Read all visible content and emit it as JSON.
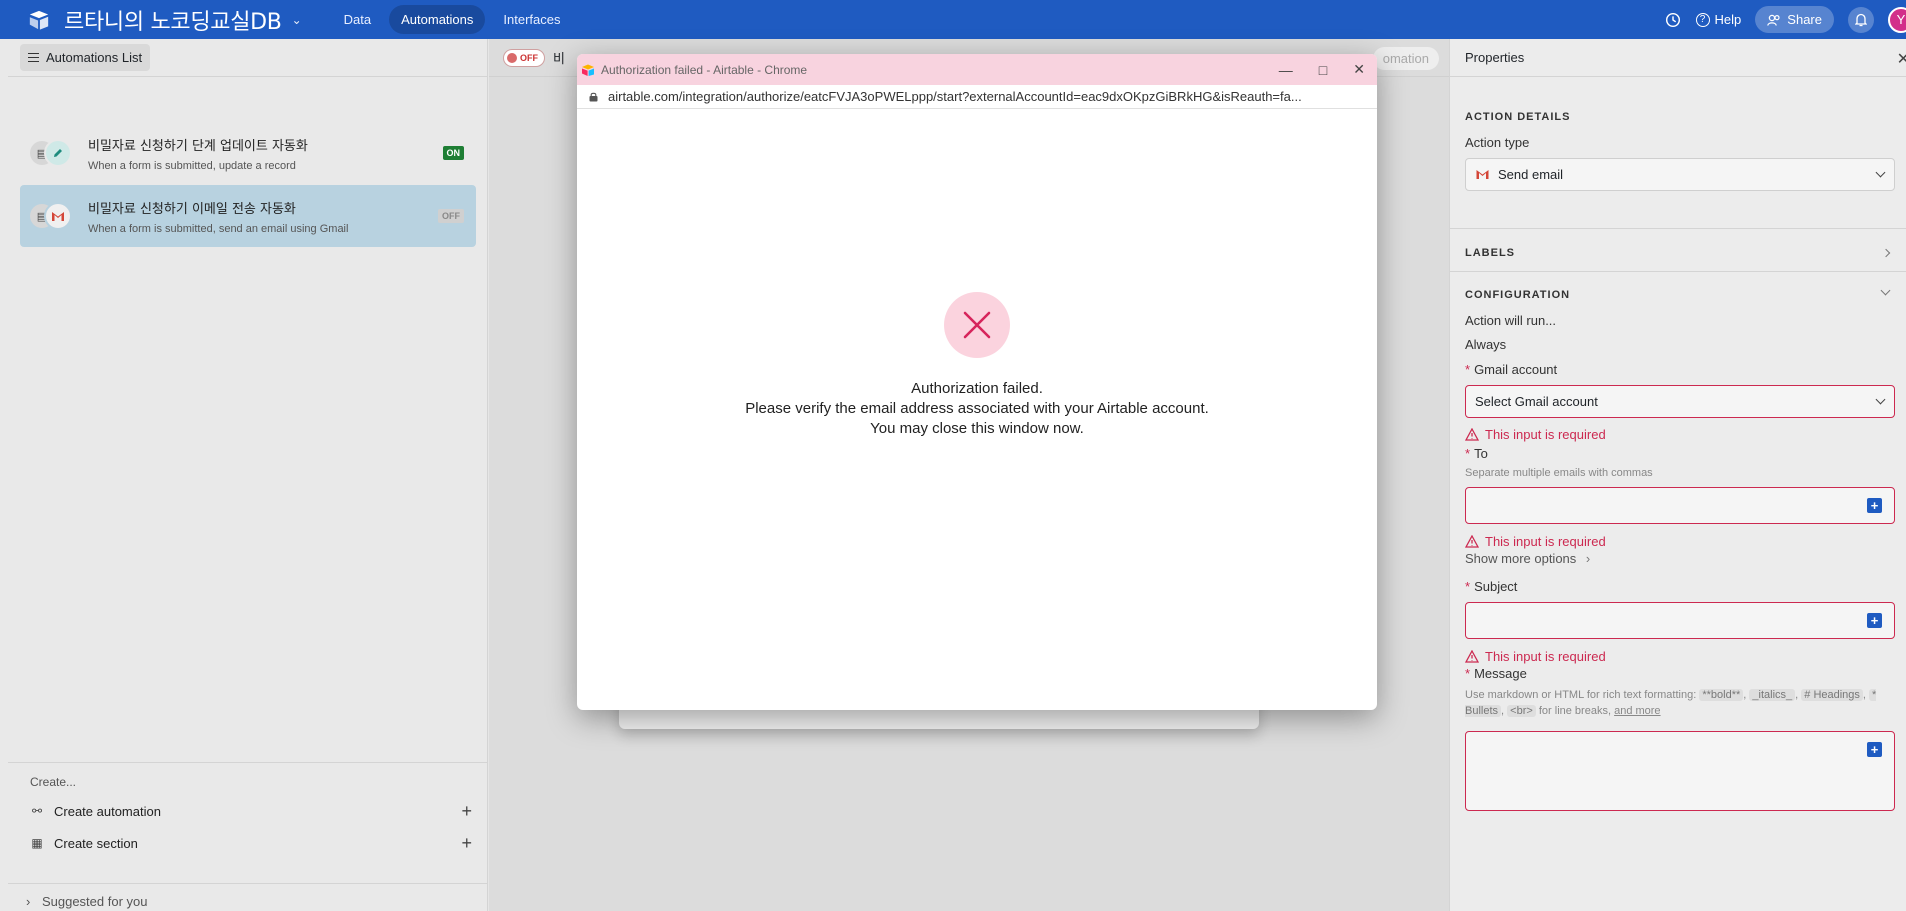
{
  "topbar": {
    "base_name": "르타니의 노코딩교실DB",
    "nav": [
      "Data",
      "Automations",
      "Interfaces"
    ],
    "help_label": "Help",
    "share_label": "Share",
    "avatar_initial": "Y",
    "accent_color": "#1f5bc1"
  },
  "automations_list": {
    "header_button": "Automations List",
    "items": [
      {
        "name": "비밀자료 신청하기 단계 업데이트 자동화",
        "description": "When a form is submitted, update a record",
        "status": "ON"
      },
      {
        "name": "비밀자료 신청하기 이메일 전송 자동화",
        "description": "When a form is submitted, send an email using Gmail",
        "status": "OFF"
      }
    ],
    "create_title": "Create...",
    "create_automation": "Create automation",
    "create_section": "Create section",
    "suggested": "Suggested for you"
  },
  "canvas": {
    "toggle_label": "OFF",
    "title_fragment": "비",
    "ghost_button": "omation"
  },
  "popup": {
    "window_title": "Authorization failed - Airtable - Chrome",
    "url": "airtable.com/integration/authorize/eatcFVJA3oPWELppp/start?externalAccountId=eac9dxOKpzGiBRkHG&isReauth=fa...",
    "message_line1": "Authorization failed.",
    "message_line2": "Please verify the email address associated with your Airtable account.",
    "message_line3": "You may close this window now.",
    "error_color": "#d6245c"
  },
  "properties": {
    "title": "Properties",
    "action_details": "ACTION DETAILS",
    "action_type_label": "Action type",
    "action_type_value": "Send email",
    "labels": "LABELS",
    "configuration": "CONFIGURATION",
    "action_will_run": "Action will run...",
    "always": "Always",
    "gmail_label": "Gmail account",
    "gmail_placeholder": "Select Gmail account",
    "required_msg": "This input is required",
    "to_label": "To",
    "to_hint": "Separate multiple emails with commas",
    "show_more": "Show more options",
    "subject_label": "Subject",
    "message_label": "Message",
    "message_hint_pre": "Use markdown or HTML for rich text formatting:",
    "hint_bold": "**bold**",
    "hint_italics": "_italics_",
    "hint_headings": "# Headings",
    "hint_bullets": "* Bullets",
    "hint_br": "<br>",
    "hint_mid": "for line breaks,",
    "hint_more": "and more",
    "error_color": "#cc2950"
  }
}
